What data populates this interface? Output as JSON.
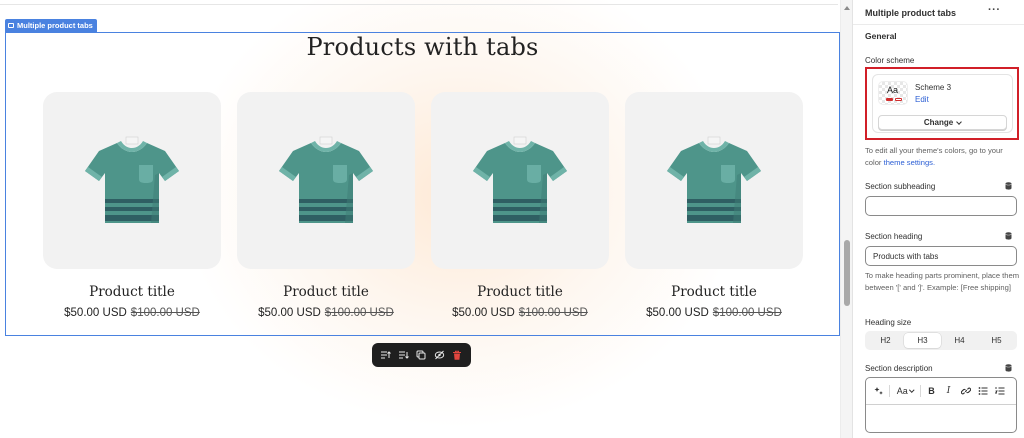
{
  "preview": {
    "section_tag": "Multiple product tabs",
    "heading": "Products with tabs",
    "products": [
      {
        "title": "Product title",
        "price": "$50.00 USD",
        "compare_price": "$100.00 USD"
      },
      {
        "title": "Product title",
        "price": "$50.00 USD",
        "compare_price": "$100.00 USD"
      },
      {
        "title": "Product title",
        "price": "$50.00 USD",
        "compare_price": "$100.00 USD"
      },
      {
        "title": "Product title",
        "price": "$50.00 USD",
        "compare_price": "$100.00 USD"
      }
    ],
    "toolbar_icons": [
      "move-up-icon",
      "move-down-icon",
      "duplicate-icon",
      "hide-icon",
      "delete-icon"
    ]
  },
  "panel": {
    "title": "Multiple product tabs",
    "more_icon": "···",
    "group_title": "General",
    "color_scheme": {
      "label": "Color scheme",
      "swatch_text": "Aa",
      "name": "Scheme 3",
      "edit_link": "Edit",
      "change_button": "Change",
      "help_prefix": "To edit all your theme's colors, go to your color ",
      "help_link": "theme settings."
    },
    "section_subheading": {
      "label": "Section subheading",
      "value": ""
    },
    "section_heading": {
      "label": "Section heading",
      "value": "Products with tabs",
      "help": "To make heading parts prominent, place them between '[' and ']'. Example: [Free shipping]"
    },
    "heading_size": {
      "label": "Heading size",
      "options": [
        "H2",
        "H3",
        "H4",
        "H5"
      ],
      "selected": "H3"
    },
    "section_description": {
      "label": "Section description",
      "font_menu": "Aa",
      "bold": "B",
      "italic": "I"
    }
  },
  "colors": {
    "selection_outline": "#4a82e0",
    "highlight_box": "#d11f28",
    "link": "#2c5fd4",
    "tshirt": "#4e958a",
    "delete_icon": "#e2463f"
  }
}
